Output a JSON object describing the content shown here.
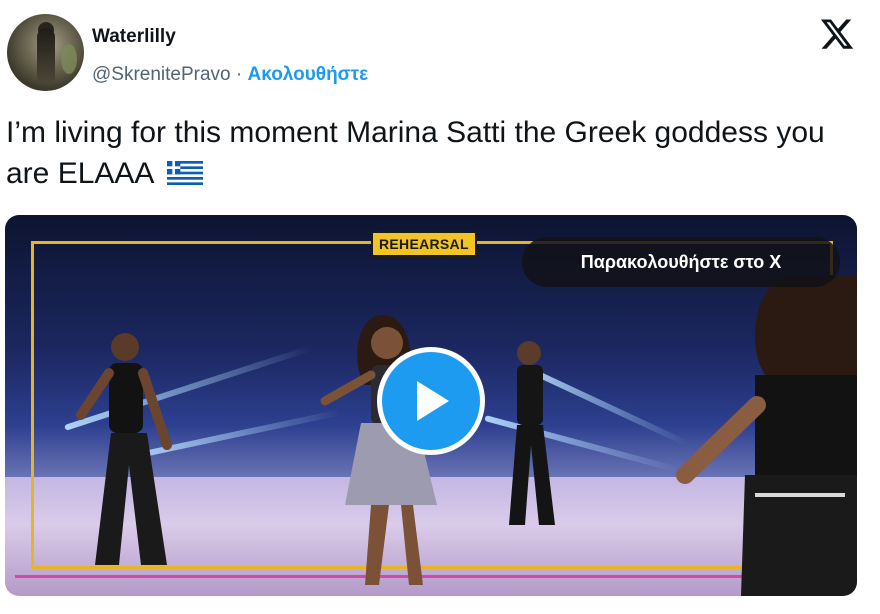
{
  "header": {
    "display_name": "Waterlilly",
    "handle": "@SkrenitePravo",
    "separator": "·",
    "follow_label": "Ακολουθήστε",
    "logo": "x-logo-icon"
  },
  "tweet": {
    "text": "I’m living for this moment Marina Satti the Greek goddess you are ELAAA",
    "flag": "greece-flag-icon"
  },
  "media": {
    "badge": "REHEARSAL",
    "watch_label": "Παρακολουθήστε στο X",
    "play_icon": "play-icon",
    "colors": {
      "accent": "#1d9bf0",
      "badge": "#f2c428",
      "frame_yellow": "#e7b424",
      "frame_pink": "#d14aa8"
    }
  }
}
